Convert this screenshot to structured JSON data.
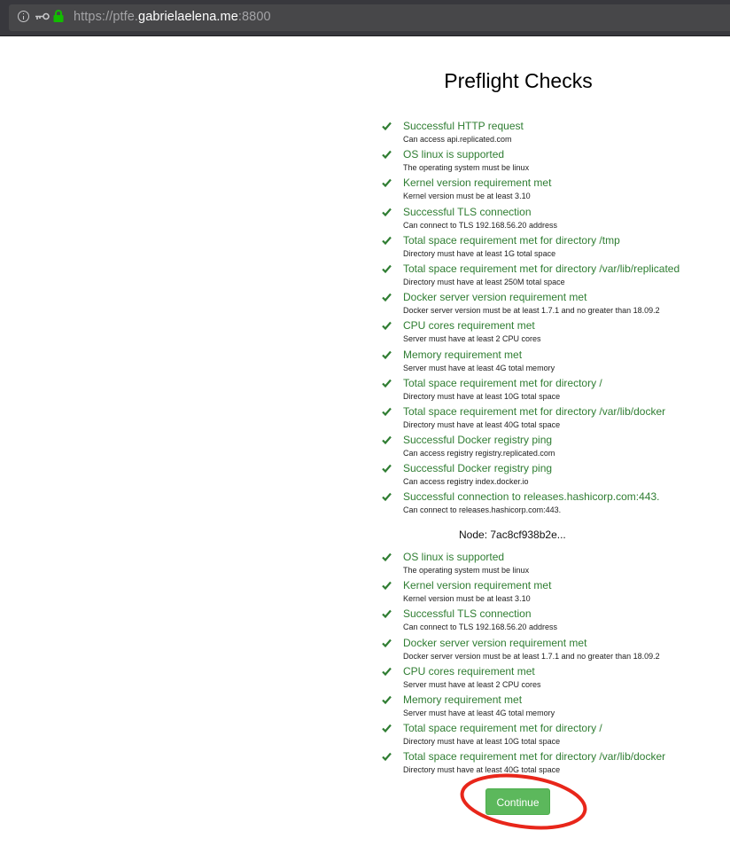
{
  "browser": {
    "url_scheme": "https://ptfe.",
    "url_host": "gabrielaelena.me",
    "url_port": ":8800"
  },
  "page": {
    "title": "Preflight Checks",
    "node_label": "Node: 7ac8cf938b2e...",
    "continue_label": "Continue"
  },
  "colors": {
    "check_green": "#2f7d32",
    "button_green": "#5cb85c",
    "annotation_red": "#e8261a"
  },
  "checks": [
    {
      "title": "Successful HTTP request",
      "desc": "Can access api.replicated.com"
    },
    {
      "title": "OS linux is supported",
      "desc": "The operating system must be linux"
    },
    {
      "title": "Kernel version requirement met",
      "desc": "Kernel version must be at least 3.10"
    },
    {
      "title": "Successful TLS connection",
      "desc": "Can connect to TLS 192.168.56.20 address"
    },
    {
      "title": "Total space requirement met for directory /tmp",
      "desc": "Directory must have at least 1G total space"
    },
    {
      "title": "Total space requirement met for directory /var/lib/replicated",
      "desc": "Directory must have at least 250M total space"
    },
    {
      "title": "Docker server version requirement met",
      "desc": "Docker server version must be at least 1.7.1 and no greater than 18.09.2"
    },
    {
      "title": "CPU cores requirement met",
      "desc": "Server must have at least 2 CPU cores"
    },
    {
      "title": "Memory requirement met",
      "desc": "Server must have at least 4G total memory"
    },
    {
      "title": "Total space requirement met for directory /",
      "desc": "Directory must have at least 10G total space"
    },
    {
      "title": "Total space requirement met for directory /var/lib/docker",
      "desc": "Directory must have at least 40G total space"
    },
    {
      "title": "Successful Docker registry ping",
      "desc": "Can access registry registry.replicated.com"
    },
    {
      "title": "Successful Docker registry ping",
      "desc": "Can access registry index.docker.io"
    },
    {
      "title": "Successful connection to releases.hashicorp.com:443.",
      "desc": "Can connect to releases.hashicorp.com:443."
    }
  ],
  "node_checks": [
    {
      "title": "OS linux is supported",
      "desc": "The operating system must be linux"
    },
    {
      "title": "Kernel version requirement met",
      "desc": "Kernel version must be at least 3.10"
    },
    {
      "title": "Successful TLS connection",
      "desc": "Can connect to TLS 192.168.56.20 address"
    },
    {
      "title": "Docker server version requirement met",
      "desc": "Docker server version must be at least 1.7.1 and no greater than 18.09.2"
    },
    {
      "title": "CPU cores requirement met",
      "desc": "Server must have at least 2 CPU cores"
    },
    {
      "title": "Memory requirement met",
      "desc": "Server must have at least 4G total memory"
    },
    {
      "title": "Total space requirement met for directory /",
      "desc": "Directory must have at least 10G total space"
    },
    {
      "title": "Total space requirement met for directory /var/lib/docker",
      "desc": "Directory must have at least 40G total space"
    }
  ]
}
